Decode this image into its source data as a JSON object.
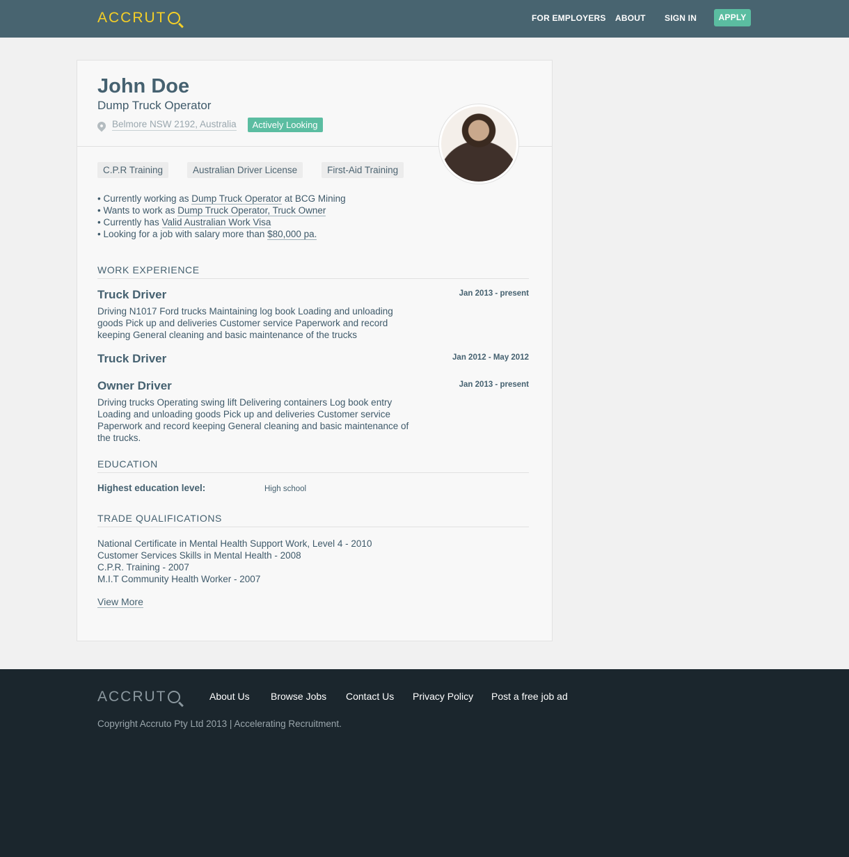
{
  "header": {
    "logo": "ACCRUT",
    "nav": [
      "FOR EMPLOYERS",
      "ABOUT",
      "SIGN IN"
    ],
    "apply_label": "APPLY"
  },
  "profile": {
    "name": "John Doe",
    "title": "Dump Truck Operator",
    "location": "Belmore NSW 2192, Australia",
    "status": "Actively Looking",
    "tags": [
      "C.P.R Training",
      "Australian Driver License",
      "First-Aid Training"
    ],
    "summary": [
      {
        "prefix": "• Currently working as ",
        "link": "Dump Truck Operator",
        "suffix": " at BCG Mining"
      },
      {
        "prefix": "• Wants to work as ",
        "link": "Dump Truck Operator, Truck Owner",
        "suffix": ""
      },
      {
        "prefix": "• Currently has ",
        "link": "Valid Australian Work Visa",
        "suffix": ""
      },
      {
        "prefix": "• Looking for a job with salary more than ",
        "link": "$80,000 pa.",
        "suffix": ""
      }
    ]
  },
  "work_experience": {
    "heading": "WORK EXPERIENCE",
    "jobs": [
      {
        "role": "Truck Driver",
        "dates": "Jan 2013 - present",
        "description": "Driving N1017 Ford trucks Maintaining log book Loading and unloading goods Pick up and deliveries Customer service Paperwork and record keeping General cleaning and basic maintenance of the trucks"
      },
      {
        "role": "Truck Driver",
        "dates": "Jan 2012 - May 2012",
        "description": ""
      },
      {
        "role": "Owner Driver",
        "dates": "Jan 2013 - present",
        "description": "Driving trucks Operating swing lift Delivering containers Log book entry Loading and unloading goods Pick up and deliveries Customer service Paperwork and record keeping General cleaning and basic maintenance of the trucks."
      }
    ]
  },
  "education": {
    "heading": "EDUCATION",
    "label": "Highest education level:",
    "value": "High school"
  },
  "trade": {
    "heading": "TRADE QUALIFICATIONS",
    "items": [
      "National Certificate in Mental Health Support Work, Level 4 - 2010",
      "Customer Services Skills in Mental Health - 2008",
      "C.P.R. Training - 2007",
      "M.I.T Community Health Worker - 2007"
    ],
    "view_more": "View More"
  },
  "footer": {
    "logo": "ACCRUT",
    "links": [
      "About Us",
      "Browse Jobs",
      "Contact Us",
      "Privacy Policy",
      "Post a free job ad"
    ],
    "copyright": "Copyright Accruto Pty Ltd 2013 | Accelerating Recruitment."
  },
  "colors": {
    "header_bg": "#486470",
    "logo_yellow": "#f5cf27",
    "accent_green": "#5bbda1",
    "footer_bg": "#1b262d",
    "text": "#3f5a6a"
  },
  "icons": {
    "location": "map-pin-icon",
    "logo_mark": "magnifier-icon"
  }
}
